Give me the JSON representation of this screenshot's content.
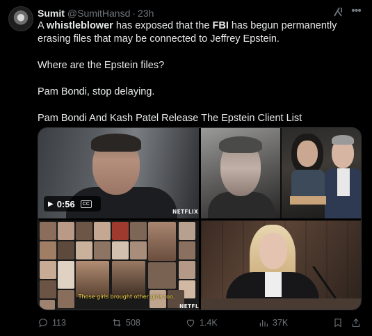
{
  "author": {
    "display_name": "Sumit",
    "handle": "@SumitHansd",
    "separator": "·",
    "time": "23h"
  },
  "icons": {
    "grok": "grok-icon",
    "more": "more-icon"
  },
  "tweet": {
    "line1_pre": "A ",
    "line1_bold1": "whistleblower",
    "line1_mid": " has exposed that the ",
    "line1_bold2": "FBI",
    "line1_post": " has begun permanently erasing files that may be connected to Jeffrey Epstein.",
    "para2": "Where are the Epstein files?",
    "para3": "Pam Bondi, stop delaying.",
    "para4": "Pam Bondi And Kash Patel Release The Epstein Client List"
  },
  "media": {
    "video_duration": "0:56",
    "cc_label": "CC",
    "watermark": "NETFLIX",
    "subtitle": "Those girls brought other girls too."
  },
  "actions": {
    "replies": "113",
    "reposts": "508",
    "likes": "1.4K",
    "views": "37K"
  }
}
